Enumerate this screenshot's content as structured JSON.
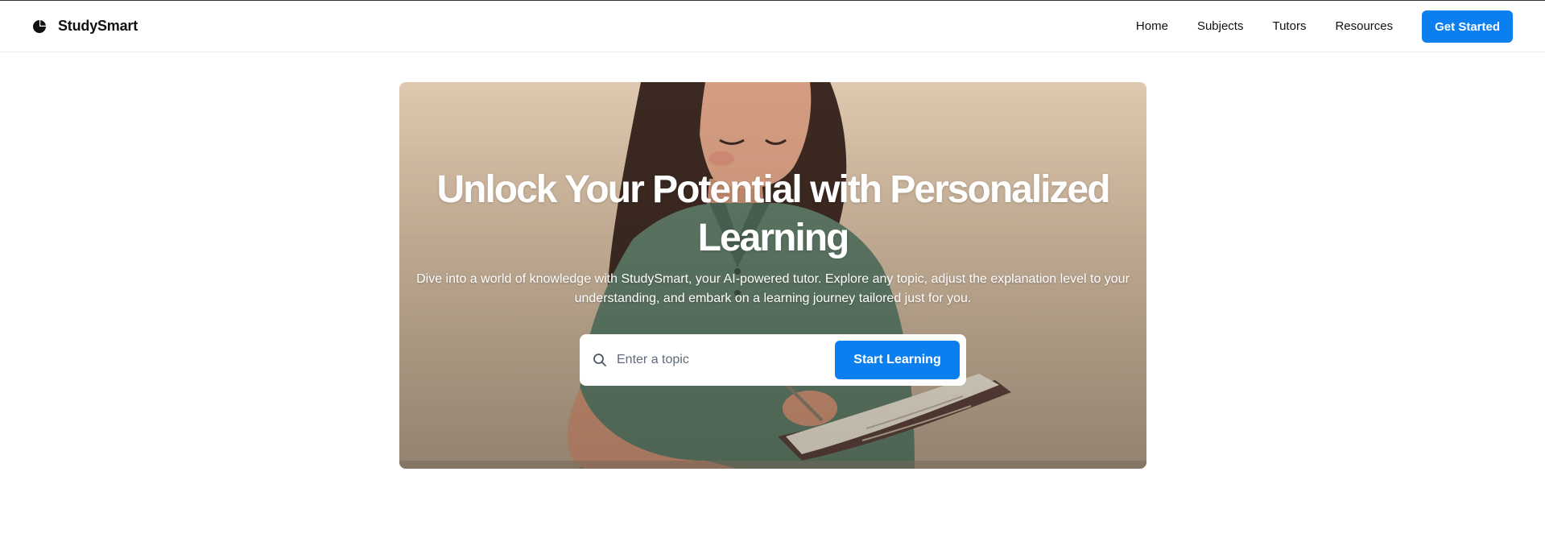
{
  "header": {
    "brand": {
      "name": "StudySmart",
      "icon": "logo-icon"
    },
    "nav": [
      {
        "label": "Home"
      },
      {
        "label": "Subjects"
      },
      {
        "label": "Tutors"
      },
      {
        "label": "Resources"
      }
    ],
    "cta_label": "Get Started"
  },
  "hero": {
    "title": "Unlock Your Potential with Personalized Learning",
    "subtitle": "Dive into a world of knowledge with StudySmart, your AI-powered tutor. Explore any topic, adjust the explanation level to your understanding, and embark on a learning journey tailored just for you.",
    "image": "student-studying-illustration",
    "search": {
      "icon": "search-icon",
      "value": "",
      "placeholder": "Enter a topic",
      "button_label": "Start Learning"
    }
  },
  "colors": {
    "accent": "#0b7ff0",
    "text": "#111111",
    "background": "#ffffff",
    "hero_beige": "#e3ccb3"
  }
}
